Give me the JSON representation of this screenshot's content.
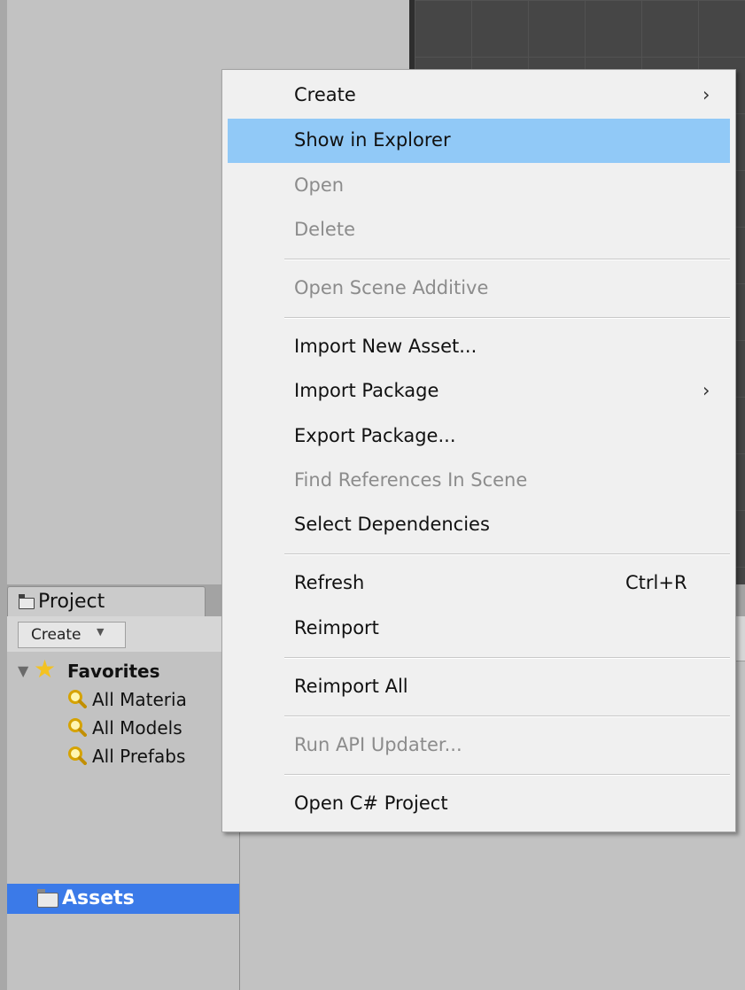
{
  "project_panel": {
    "tab_label": "Project",
    "create_button": "Create",
    "create_arrow": "▼",
    "favorites_label": "Favorites",
    "favorites": [
      {
        "label": "All Materia"
      },
      {
        "label": "All Models"
      },
      {
        "label": "All Prefabs"
      }
    ],
    "assets_label": "Assets"
  },
  "context_menu": {
    "items": [
      {
        "label": "Create",
        "arrow": "›",
        "enabled": true
      },
      {
        "label": "Show in Explorer",
        "enabled": true,
        "highlighted": true
      },
      {
        "label": "Open",
        "enabled": false
      },
      {
        "label": "Delete",
        "enabled": false
      },
      {
        "label": "Open Scene Additive",
        "enabled": false
      },
      {
        "label": "Import New Asset...",
        "enabled": true
      },
      {
        "label": "Import Package",
        "arrow": "›",
        "enabled": true
      },
      {
        "label": "Export Package...",
        "enabled": true
      },
      {
        "label": "Find References In Scene",
        "enabled": false
      },
      {
        "label": "Select Dependencies",
        "enabled": true
      },
      {
        "label": "Refresh",
        "shortcut": "Ctrl+R",
        "enabled": true
      },
      {
        "label": "Reimport",
        "enabled": true
      },
      {
        "label": "Reimport All",
        "enabled": true
      },
      {
        "label": "Run API Updater...",
        "enabled": false
      },
      {
        "label": "Open C# Project",
        "enabled": true
      }
    ]
  },
  "colors": {
    "selection": "#3b7ae8",
    "menu_hover": "#91c9f7",
    "scene_bg": "#464646",
    "star": "#f3c221"
  }
}
